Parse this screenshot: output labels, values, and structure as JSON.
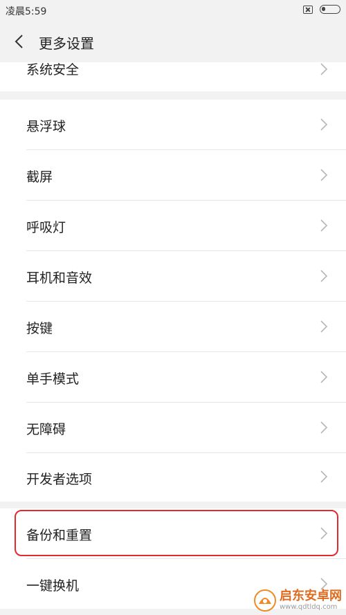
{
  "status_bar": {
    "time": "凌晨5:59"
  },
  "header": {
    "title": "更多设置",
    "back_icon": "chevron-left-icon"
  },
  "items": [
    {
      "label": "系统安全"
    },
    {
      "label": "悬浮球"
    },
    {
      "label": "截屏"
    },
    {
      "label": "呼吸灯"
    },
    {
      "label": "耳机和音效"
    },
    {
      "label": "按键"
    },
    {
      "label": "单手模式"
    },
    {
      "label": "无障碍"
    },
    {
      "label": "开发者选项"
    },
    {
      "label": "备份和重置"
    },
    {
      "label": "一键换机"
    }
  ],
  "highlighted_item": "备份和重置",
  "highlight_color": "#e5282b",
  "watermark": {
    "name": "启东安卓网",
    "url": "www.qdtldq.com"
  }
}
